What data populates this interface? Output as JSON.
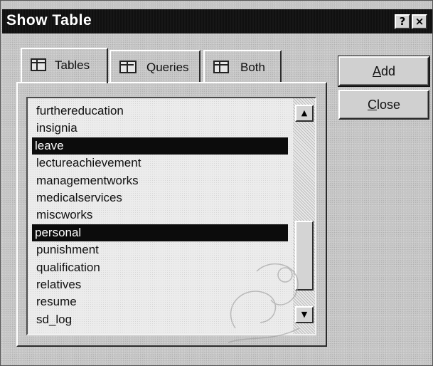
{
  "window": {
    "title": "Show Table",
    "help_button": "?",
    "close_button": "×"
  },
  "tabs": [
    {
      "label": "Tables",
      "icon": "table-icon",
      "active": true
    },
    {
      "label": "Queries",
      "icon": "query-icon",
      "active": false
    },
    {
      "label": "Both",
      "icon": "both-icon",
      "active": false
    }
  ],
  "list": {
    "items": [
      "furthereducation",
      "insignia",
      "leave",
      "lectureachievement",
      "managementworks",
      "medicalservices",
      "miscworks",
      "personal",
      "punishment",
      "qualification",
      "relatives",
      "resume",
      "sd_log"
    ],
    "selected": [
      "leave",
      "personal"
    ]
  },
  "scrollbar": {
    "up_arrow": "▲",
    "down_arrow": "▼"
  },
  "buttons": {
    "add_mnemonic": "A",
    "add_rest": "dd",
    "close_mnemonic": "C",
    "close_rest": "lose"
  }
}
